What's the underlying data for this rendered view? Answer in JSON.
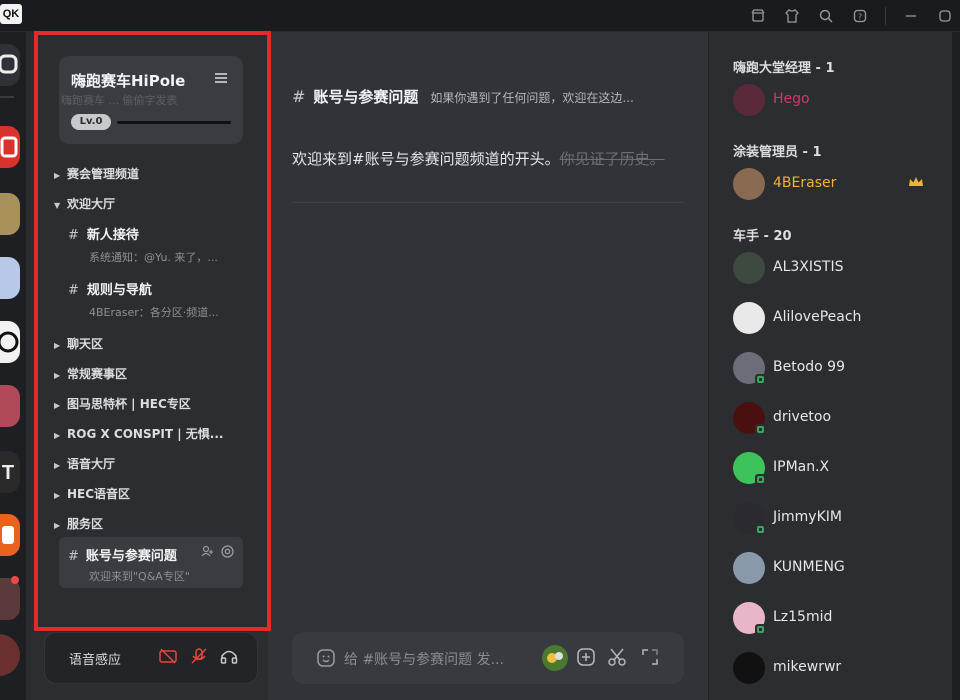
{
  "app": {
    "logo_text": "QK"
  },
  "topbar": {
    "icons": [
      "store-icon",
      "shirt-icon",
      "search-icon",
      "help-icon",
      "minimize-icon",
      "maximize-icon"
    ]
  },
  "server": {
    "name": "嗨跑赛车HiPole",
    "banner_text": "嗨跑赛车 ... 偷偷字发表",
    "level": "Lv.0"
  },
  "sidebar": {
    "categories": [
      {
        "label": "赛会管理频道"
      },
      {
        "label": "欢迎大厅"
      },
      {
        "label": "聊天区"
      },
      {
        "label": "常规赛事区"
      },
      {
        "label": "图马思特杯 | HEC专区"
      },
      {
        "label": "ROG X CONSPIT | 无惧..."
      },
      {
        "label": "语音大厅"
      },
      {
        "label": "HEC语音区"
      },
      {
        "label": "服务区"
      }
    ],
    "channels": [
      {
        "name": "新人接待",
        "preview": "系统通知：@Yu. 来了，..."
      },
      {
        "name": "规则与导航",
        "preview": "4BEraser：各分区·频道..."
      }
    ],
    "active_channel": {
      "name": "账号与参赛问题",
      "preview": "欢迎来到\"Q&A专区\""
    }
  },
  "voice": {
    "label": "语音感应"
  },
  "main": {
    "channel_name": "账号与参赛问题",
    "topic": "如果你遇到了任何问题，欢迎在这边...",
    "welcome": "欢迎来到#账号与参赛问题频道的开头。",
    "welcome_history": "你见证了历史。",
    "composer_placeholder": "给 #账号与参赛问题 发..."
  },
  "members": {
    "groups": [
      {
        "title": "嗨跑大堂经理 - 1"
      },
      {
        "title": "涂装管理员 - 1"
      },
      {
        "title": "车手 - 20"
      }
    ],
    "list": [
      {
        "name": "Hego",
        "color": "#d6336c",
        "avatar": "#5a2a3a"
      },
      {
        "name": "4BEraser",
        "color": "#f0b232",
        "avatar": "#8a6a50"
      },
      {
        "name": "AL3XISTIS",
        "color": "#e6e7ea",
        "avatar": "#3d4a40"
      },
      {
        "name": "AlilovePeach",
        "color": "#e6e7ea",
        "avatar": "#e9e9e9"
      },
      {
        "name": "Betodo 99",
        "color": "#e6e7ea",
        "avatar": "#6b6e78"
      },
      {
        "name": "drivetoo",
        "color": "#e6e7ea",
        "avatar": "#4a1010"
      },
      {
        "name": "IPMan.X",
        "color": "#e6e7ea",
        "avatar": "#3cc45a"
      },
      {
        "name": "JimmyKIM",
        "color": "#e6e7ea",
        "avatar": "#2a2a30"
      },
      {
        "name": "KUNMENG",
        "color": "#e6e7ea",
        "avatar": "#8a99aa"
      },
      {
        "name": "Lz15mid",
        "color": "#e6e7ea",
        "avatar": "#e8b6c8"
      },
      {
        "name": "mikewrwr",
        "color": "#e6e7ea",
        "avatar": "#111111"
      }
    ]
  },
  "colors": {
    "highlight": "#e52a2a",
    "accent_red": "#e8453c",
    "online": "#3ba55d"
  }
}
